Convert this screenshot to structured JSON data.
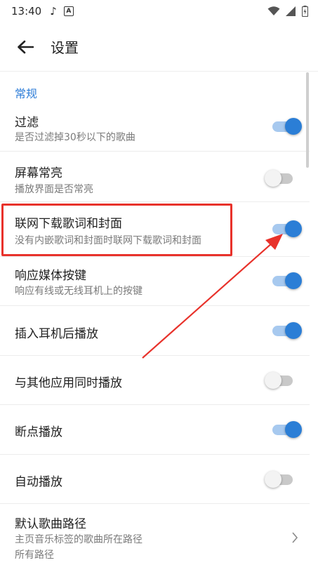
{
  "status_bar": {
    "time": "13:40",
    "a_badge": "A"
  },
  "toolbar": {
    "title": "设置"
  },
  "section": {
    "header": "常规"
  },
  "rows": [
    {
      "title": "过滤",
      "summary": "是否过滤掉30秒以下的歌曲",
      "switch": "on"
    },
    {
      "title": "屏幕常亮",
      "summary": "播放界面是否常亮",
      "switch": "off"
    },
    {
      "title": "联网下载歌词和封面",
      "summary": "没有内嵌歌词和封面时联网下载歌词和封面",
      "switch": "on"
    },
    {
      "title": "响应媒体按键",
      "summary": "响应有线或无线耳机上的按键",
      "switch": "on"
    },
    {
      "title": "插入耳机后播放",
      "switch": "on"
    },
    {
      "title": "与其他应用同时播放",
      "switch": "off"
    },
    {
      "title": "断点播放",
      "switch": "on"
    },
    {
      "title": "自动播放",
      "switch": "off"
    },
    {
      "title": "默认歌曲路径",
      "summary": "主页音乐标签的歌曲所在路径",
      "summary2": "所有路径"
    }
  ],
  "colors": {
    "accent": "#2b7ed6",
    "highlight": "#e8322b",
    "section_header": "#2f7ed8"
  }
}
